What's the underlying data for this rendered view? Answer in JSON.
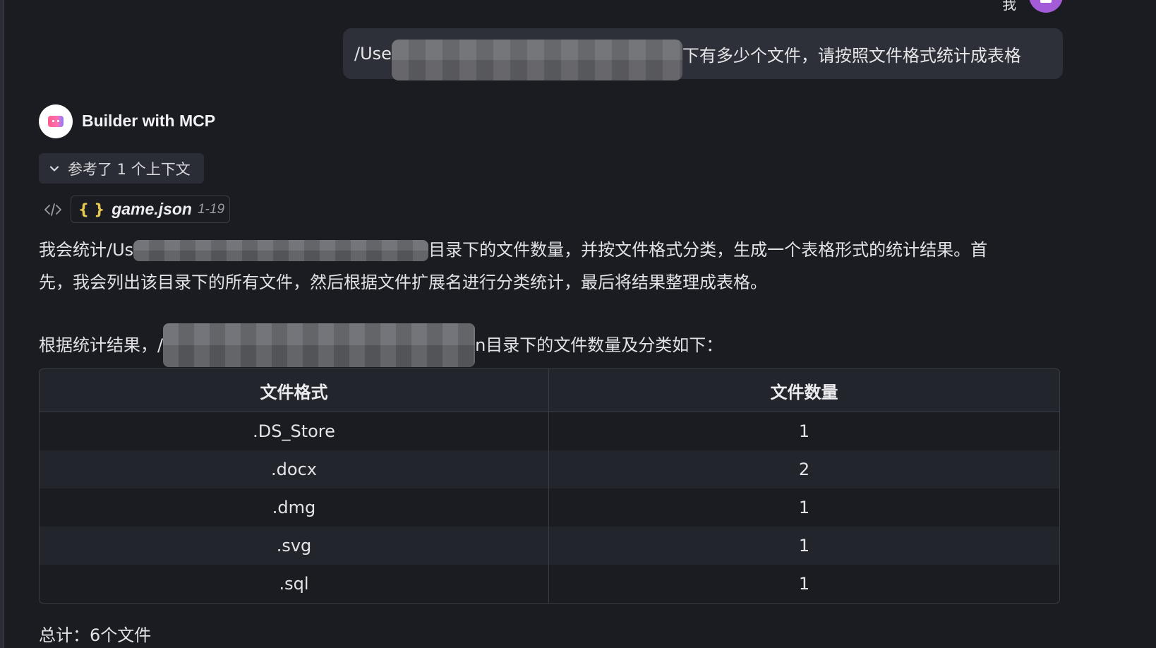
{
  "user": {
    "name_partial": "我",
    "message_prefix": "/Use",
    "message_suffix": "下有多少个文件，请按照文件格式统计成表格"
  },
  "assistant": {
    "name": "Builder with MCP",
    "context_label": "参考了 1 个上下文",
    "file_ref": {
      "icon": "{ }",
      "name": "game.json",
      "range": "1-19"
    },
    "para1_prefix": "我会统计/Us",
    "para1_suffix": "目录下的文件数量，并按文件格式分类，生成一个表格形式的统计结果。首",
    "para2": "先，我会列出该目录下的所有文件，然后根据文件扩展名进行分类统计，最后将结果整理成表格。",
    "para3_prefix": "根据统计结果，/",
    "para3_suffix": "n目录下的文件数量及分类如下：",
    "table": {
      "headers": [
        "文件格式",
        "文件数量"
      ],
      "rows": [
        [
          ".DS_Store",
          "1"
        ],
        [
          ".docx",
          "2"
        ],
        [
          ".dmg",
          "1"
        ],
        [
          ".svg",
          "1"
        ],
        [
          ".sql",
          "1"
        ]
      ]
    },
    "total": "总计：6个文件"
  }
}
